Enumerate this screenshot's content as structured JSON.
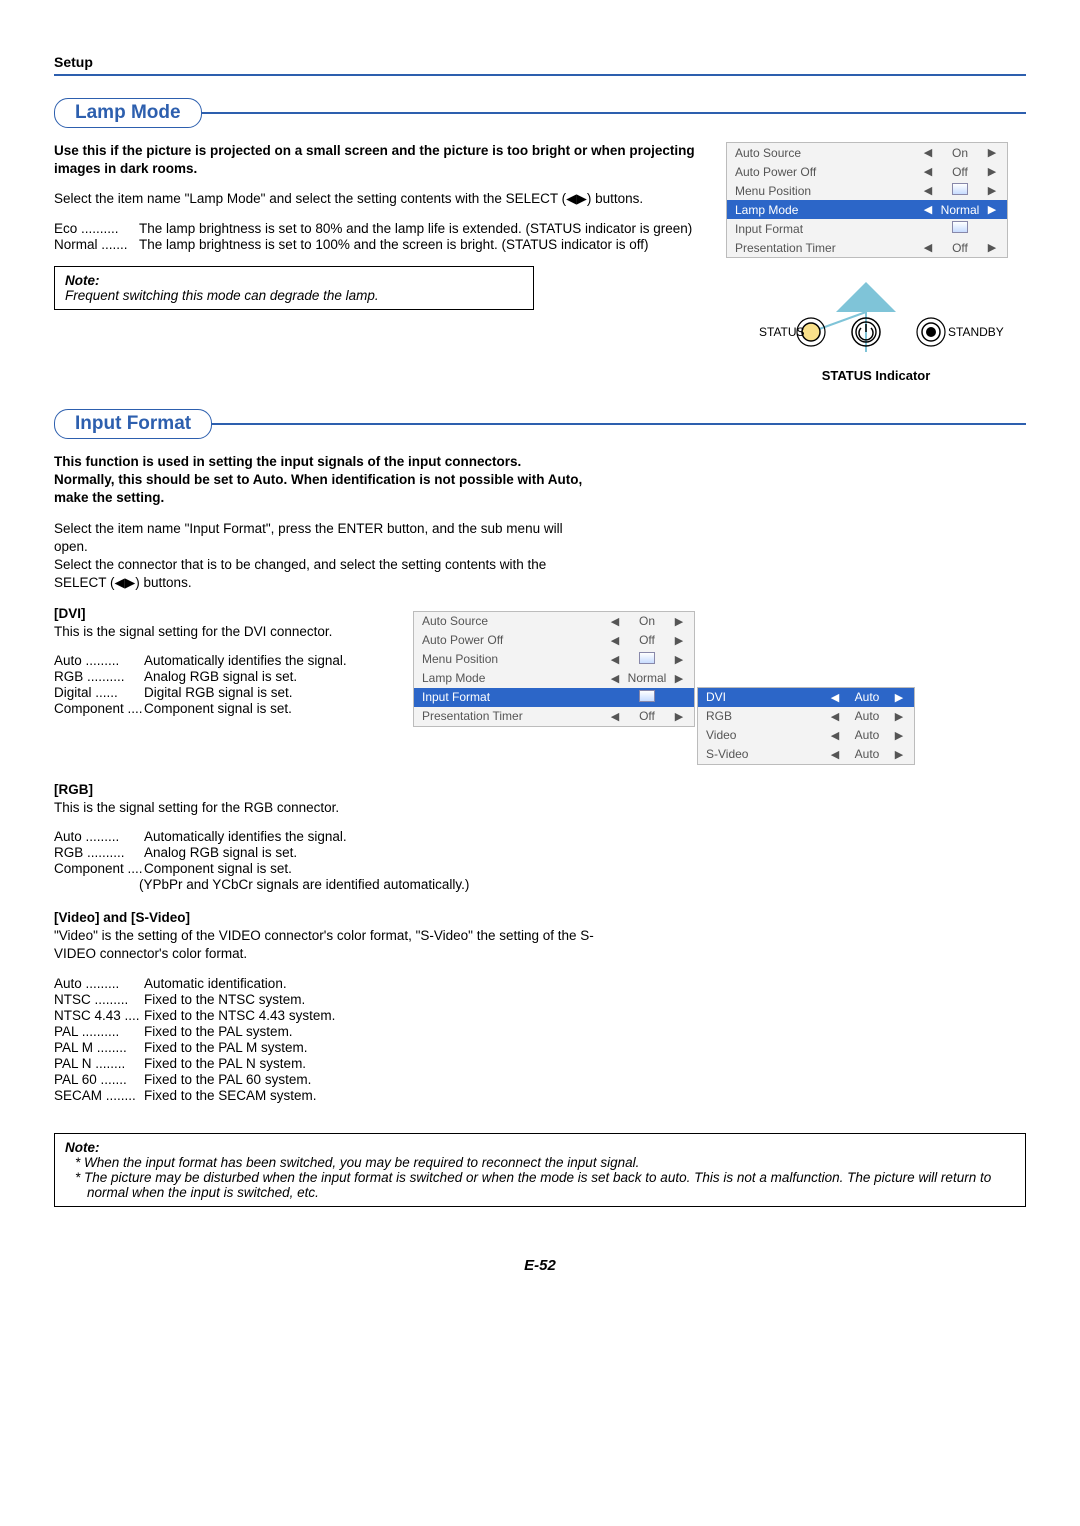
{
  "header": {
    "setup": "Setup"
  },
  "lampMode": {
    "heading": "Lamp Mode",
    "intro_bold": "Use this if the picture is projected on a small screen and the picture is too bright or when projecting images in dark rooms.",
    "para1": "Select the item name \"Lamp Mode\" and select the setting contents with the SELECT (◀▶) buttons.",
    "defs": [
      {
        "k": "Eco",
        "v": "The lamp brightness is set to 80% and the lamp life is extended. (STATUS indicator is green)"
      },
      {
        "k": "Normal",
        "v": "The lamp brightness is set to 100% and the screen is bright. (STATUS indicator is off)"
      }
    ],
    "note_title": "Note:",
    "note_body": "Frequent switching this mode can degrade the lamp.",
    "status_indicator_label": "STATUS Indicator",
    "diagram_status": "STATUS",
    "diagram_standby": "STANDBY"
  },
  "inputFormat": {
    "heading": "Input Format",
    "intro_bold": "This function is used in setting the input signals of the input connectors.\nNormally, this should be set to Auto. When identification is not possible with Auto, make the setting.",
    "para1": "Select the item name \"Input Format\", press the ENTER button, and the sub menu will open.",
    "para2": "Select the connector that is to be changed, and select the setting contents with the SELECT (◀▶) buttons.",
    "dvi": {
      "title": "[DVI]",
      "desc": "This is the signal setting for the DVI connector.",
      "defs": [
        {
          "k": "Auto",
          "v": "Automatically identifies the signal."
        },
        {
          "k": "RGB",
          "v": "Analog RGB signal is set."
        },
        {
          "k": "Digital",
          "v": "Digital RGB signal is set."
        },
        {
          "k": "Component",
          "v": "Component signal is set."
        }
      ]
    },
    "rgb": {
      "title": "[RGB]",
      "desc": "This is the signal setting for the RGB connector.",
      "defs": [
        {
          "k": "Auto",
          "v": "Automatically identifies the signal."
        },
        {
          "k": "RGB",
          "v": "Analog RGB signal is set."
        },
        {
          "k": "Component",
          "v": "Component signal is set."
        }
      ],
      "extra": "(YPbPr and YCbCr signals are identified automatically.)"
    },
    "video": {
      "title": "[Video] and [S-Video]",
      "desc": "\"Video\" is the setting of the VIDEO connector's color format, \"S-Video\" the setting of the S-VIDEO connector's color format.",
      "defs": [
        {
          "k": "Auto",
          "v": "Automatic identification."
        },
        {
          "k": "NTSC",
          "v": "Fixed to the NTSC system."
        },
        {
          "k": "NTSC 4.43",
          "v": "Fixed to the NTSC 4.43 system."
        },
        {
          "k": "PAL",
          "v": "Fixed to the PAL system."
        },
        {
          "k": "PAL M",
          "v": "Fixed to the PAL M system."
        },
        {
          "k": "PAL N",
          "v": "Fixed to the PAL N system."
        },
        {
          "k": "PAL 60",
          "v": "Fixed to the PAL 60 system."
        },
        {
          "k": "SECAM",
          "v": "Fixed to the SECAM system."
        }
      ]
    },
    "note_title": "Note:",
    "note_items": [
      "When the input format has been switched, you may be required to reconnect the input signal.",
      "The picture may be disturbed when the input format is switched or when the mode is set back to auto. This is not a malfunction. The picture will return to normal when the input is switched, etc."
    ]
  },
  "osd1": {
    "rows": [
      {
        "label": "Auto Source",
        "val": "On",
        "sel": false,
        "chip": false
      },
      {
        "label": "Auto Power Off",
        "val": "Off",
        "sel": false,
        "chip": false
      },
      {
        "label": "Menu Position",
        "val": "",
        "sel": false,
        "chip": true
      },
      {
        "label": "Lamp Mode",
        "val": "Normal",
        "sel": true,
        "chip": false
      },
      {
        "label": "Input Format",
        "val": "",
        "sel": false,
        "chip": true,
        "noarrows": true
      },
      {
        "label": "Presentation Timer",
        "val": "Off",
        "sel": false,
        "chip": false
      }
    ]
  },
  "osd2": {
    "rows": [
      {
        "label": "Auto Source",
        "val": "On",
        "sel": false,
        "chip": false
      },
      {
        "label": "Auto Power Off",
        "val": "Off",
        "sel": false,
        "chip": false
      },
      {
        "label": "Menu Position",
        "val": "",
        "sel": false,
        "chip": true
      },
      {
        "label": "Lamp Mode",
        "val": "Normal",
        "sel": false,
        "chip": false
      },
      {
        "label": "Input Format",
        "val": "",
        "sel": true,
        "chip": true,
        "noarrows": true
      },
      {
        "label": "Presentation Timer",
        "val": "Off",
        "sel": false,
        "chip": false
      }
    ],
    "sub": [
      {
        "label": "DVI",
        "val": "Auto",
        "sel": true
      },
      {
        "label": "RGB",
        "val": "Auto",
        "sel": false
      },
      {
        "label": "Video",
        "val": "Auto",
        "sel": false
      },
      {
        "label": "S-Video",
        "val": "Auto",
        "sel": false
      }
    ]
  },
  "footer": {
    "page": "E-52"
  }
}
